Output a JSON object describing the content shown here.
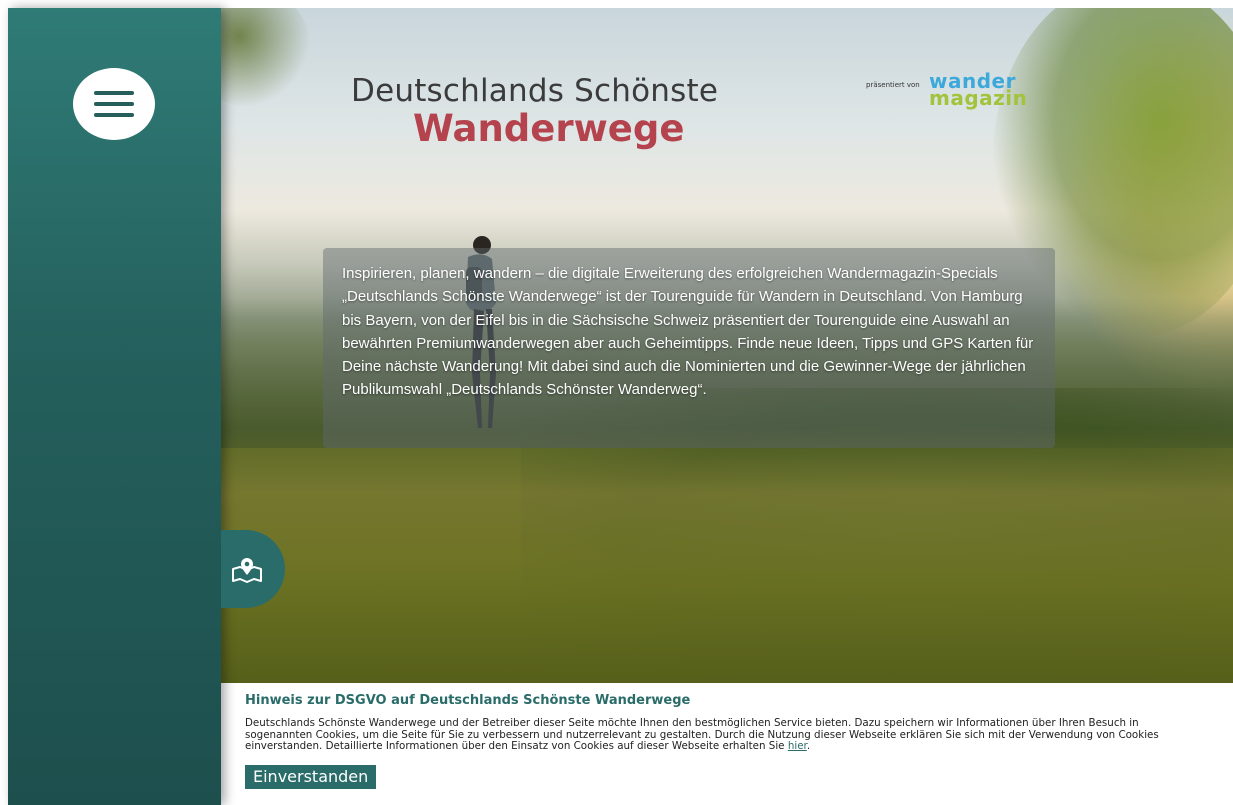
{
  "header": {
    "title_line1": "Deutschlands Schönste",
    "title_line2": "Wanderwege",
    "presented_by": "präsentiert von",
    "brand_line1": "wander",
    "brand_line2": "magazin"
  },
  "sidebar": {
    "menu_icon": "hamburger-menu-icon",
    "map_icon": "map-pin-icon"
  },
  "intro": {
    "text": "Inspirieren, planen, wandern – die digitale Erweiterung des erfolgreichen Wandermagazin-Specials „Deutschlands Schönste Wanderwege“ ist der Tourenguide für Wandern in Deutschland. Von Hamburg bis Bayern, von der Eifel bis in die Sächsische Schweiz präsentiert der Tourenguide eine Auswahl an bewährten Premiumwanderwegen aber auch Geheimtipps. Finde neue Ideen, Tipps und GPS Karten für Deine nächste Wanderung! Mit dabei sind auch die Nominierten und die Gewinner-Wege der jährlichen Publikumswahl „Deutschlands Schönster Wanderweg“."
  },
  "cookie": {
    "title": "Hinweis zur DSGVO auf Deutschlands Schönste Wanderwege",
    "text": "Deutschlands Schönste Wanderwege und der Betreiber dieser Seite möchte Ihnen den bestmöglichen Service bieten. Dazu speichern wir Informationen über Ihren Besuch in sogenannten Cookies, um die Seite für Sie zu verbessern und nutzerrelevant zu gestalten. Durch die Nutzung dieser Webseite erklären Sie sich mit der Verwendung von Cookies einverstanden. Detaillierte Informationen über den Einsatz von Cookies auf dieser Webseite erhalten Sie",
    "link_label": "hier",
    "link_suffix": ".",
    "accept_label": "Einverstanden"
  },
  "colors": {
    "sidebar": "#2a6c69",
    "title_accent": "#b5434e",
    "brand_blue": "#3ca9da",
    "brand_green": "#a2c33c"
  }
}
